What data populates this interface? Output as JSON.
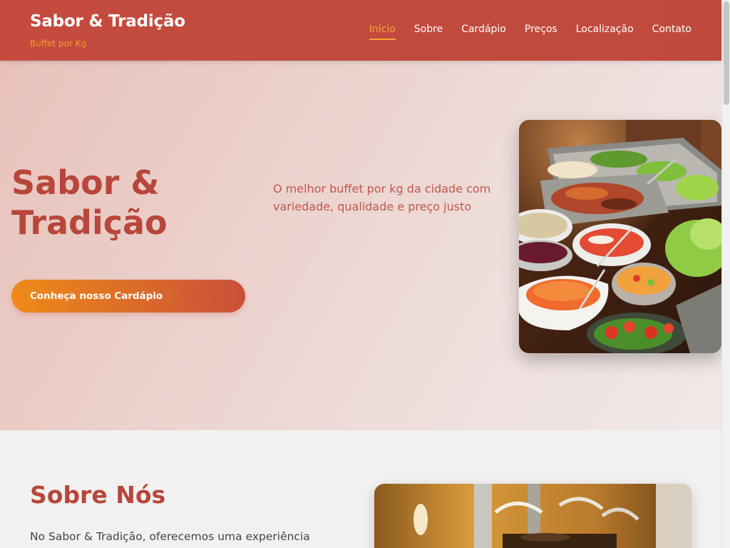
{
  "header": {
    "brand_title": "Sabor & Tradição",
    "brand_subtitle": "Buffet por Kg",
    "nav": [
      {
        "label": "Início",
        "active": true
      },
      {
        "label": "Sobre",
        "active": false
      },
      {
        "label": "Cardápio",
        "active": false
      },
      {
        "label": "Preços",
        "active": false
      },
      {
        "label": "Localização",
        "active": false
      },
      {
        "label": "Contato",
        "active": false
      }
    ]
  },
  "hero": {
    "title": "Sabor & Tradição",
    "description": "O melhor buffet por kg da cidade com variedade, qualidade e preço justo",
    "cta_label": "Conheça nosso Cardápio",
    "image_name": "buffet-salad-photo"
  },
  "about": {
    "title": "Sobre Nós",
    "text": "No Sabor & Tradição, oferecemos uma experiência",
    "image_name": "buffet-counter-photo"
  },
  "colors": {
    "header_bg": "#c44b3e",
    "accent_orange": "#f7a53a",
    "title_red": "#b8463a"
  }
}
